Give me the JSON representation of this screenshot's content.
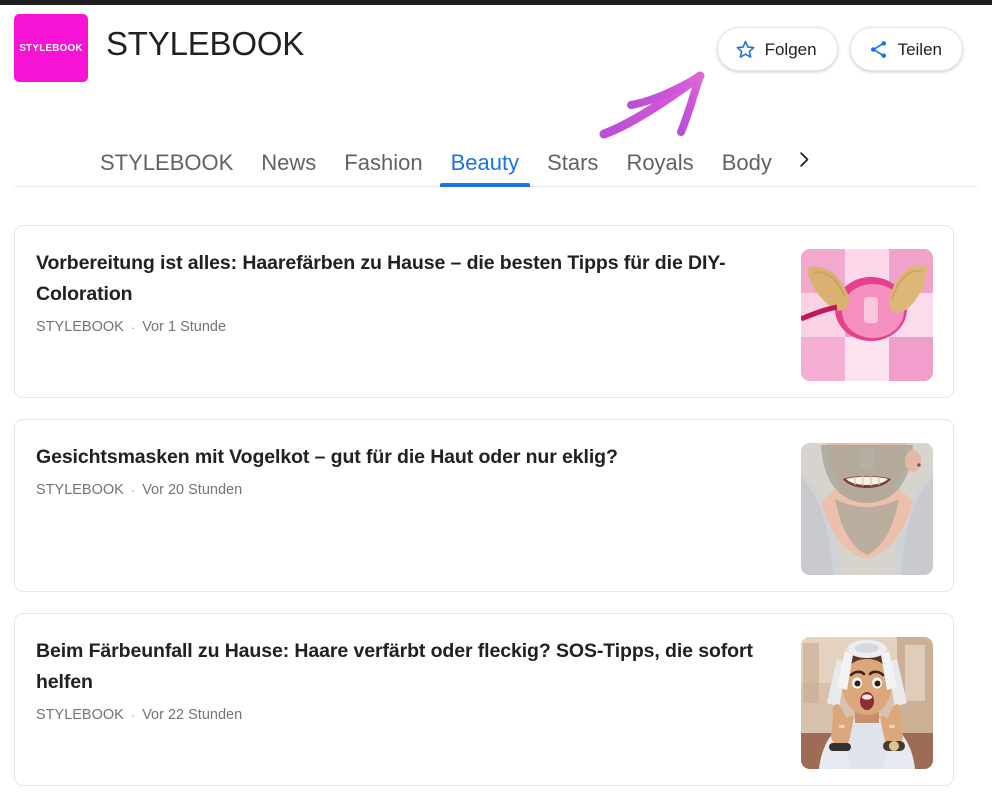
{
  "header": {
    "logo_text": "STYLEBOOK",
    "logo_color": "#f713d6",
    "title": "STYLEBOOK",
    "follow_label": "Folgen",
    "share_label": "Teilen"
  },
  "tabs": {
    "accent_color": "#1a73e8",
    "items": [
      {
        "label": "STYLEBOOK",
        "active": false
      },
      {
        "label": "News",
        "active": false
      },
      {
        "label": "Fashion",
        "active": false
      },
      {
        "label": "Beauty",
        "active": true
      },
      {
        "label": "Stars",
        "active": false
      },
      {
        "label": "Royals",
        "active": false
      },
      {
        "label": "Body",
        "active": false
      }
    ],
    "more_icon": "chevron-right-icon"
  },
  "annotation": {
    "type": "hand-drawn-arrow",
    "color": "#c24fd0",
    "direction": "up-right"
  },
  "feed": {
    "separator": "·",
    "articles": [
      {
        "title": "Vorbereitung ist alles: Haarefärben zu Hause – die besten Tipps für die DIY-Coloration",
        "source": "STYLEBOOK",
        "time": "Vor 1 Stunde",
        "thumb": "hair-dye-bowl-pink"
      },
      {
        "title": "Gesichtsmasken mit Vogelkot – gut für die Haut oder nur eklig?",
        "source": "STYLEBOOK",
        "time": "Vor 20 Stunden",
        "thumb": "face-mask-grey"
      },
      {
        "title": "Beim Färbeunfall zu Hause: Haare verfärbt oder fleckig? SOS-Tipps, die sofort helfen",
        "source": "STYLEBOOK",
        "time": "Vor 22 Stunden",
        "thumb": "woman-foils-shocked"
      }
    ]
  }
}
